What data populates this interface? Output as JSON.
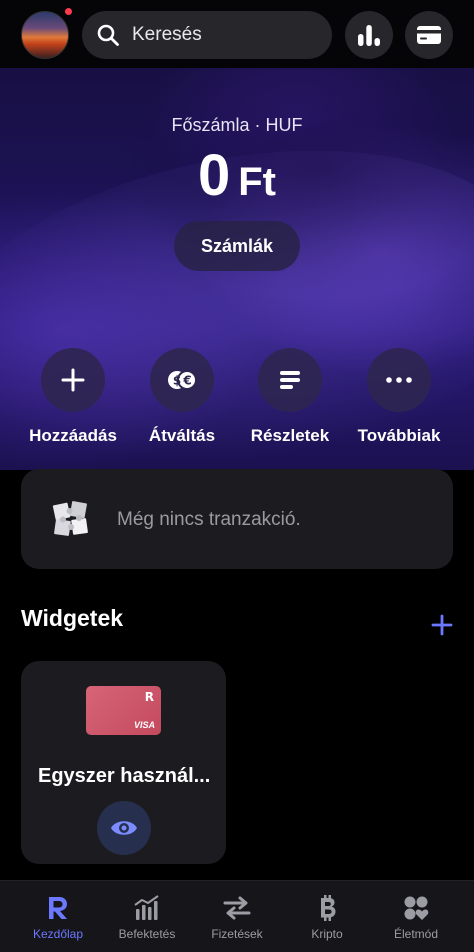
{
  "header": {
    "search_placeholder": "Keresés",
    "has_notification_dot": true
  },
  "balance": {
    "label": "Főszámla · HUF",
    "amount": "0",
    "currency": "Ft",
    "accounts_button": "Számlák"
  },
  "actions": [
    {
      "label": "Hozzáadás",
      "icon": "plus-icon"
    },
    {
      "label": "Átváltás",
      "icon": "exchange-icon"
    },
    {
      "label": "Részletek",
      "icon": "details-icon"
    },
    {
      "label": "Továbbiak",
      "icon": "more-icon"
    }
  ],
  "transactions": {
    "empty_text": "Még nincs tranzakció."
  },
  "widgets": {
    "title": "Widgetek",
    "card": {
      "name": "Egyszer használ...",
      "card_brand": "VISA",
      "card_logo": "R",
      "card_color": "#d66577"
    }
  },
  "tabs": [
    {
      "label": "Kezdőlap",
      "active": true
    },
    {
      "label": "Befektetés",
      "active": false
    },
    {
      "label": "Fizetések",
      "active": false
    },
    {
      "label": "Kripto",
      "active": false
    },
    {
      "label": "Életmód",
      "active": false
    }
  ],
  "colors": {
    "accent": "#6b78ff",
    "hero_purple": "#2a1a78",
    "card_bg": "#1c1c20"
  }
}
